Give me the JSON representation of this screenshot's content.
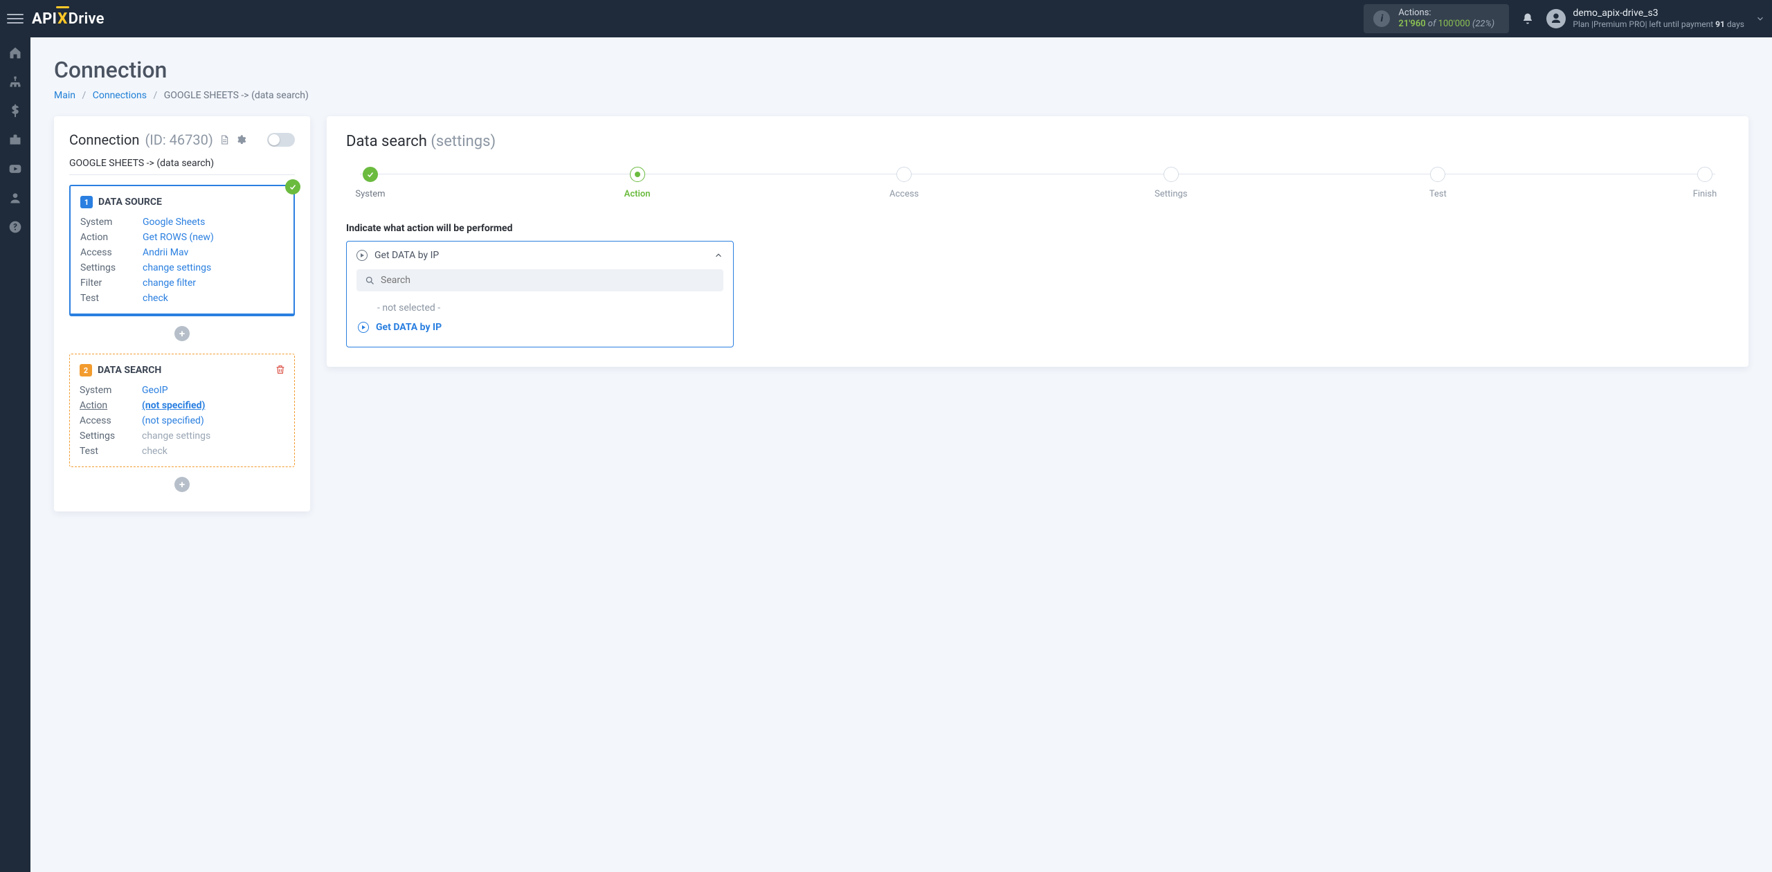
{
  "header": {
    "logo_parts": {
      "a": "API",
      "x": "X",
      "d": "Drive"
    },
    "actions_label": "Actions:",
    "actions_current": "21'960",
    "actions_of": " of ",
    "actions_total": "100'000",
    "actions_pct": "(22%)",
    "user_name": "demo_apix-drive_s3",
    "plan_prefix": "Plan ",
    "plan_name": "|Premium PRO|",
    "plan_suffix": " left until payment ",
    "plan_days": "91",
    "plan_days_unit": " days"
  },
  "page": {
    "title": "Connection",
    "crumb_main": "Main",
    "crumb_connections": "Connections",
    "crumb_current": "GOOGLE SHEETS -> (data search)"
  },
  "left_card": {
    "head_label": "Connection ",
    "head_id": "(ID: 46730)",
    "subtitle": "GOOGLE SHEETS -> (data search)",
    "block1": {
      "num": "1",
      "title": "DATA SOURCE",
      "rows": {
        "system_k": "System",
        "system_v": "Google Sheets",
        "action_k": "Action",
        "action_v": "Get ROWS (new)",
        "access_k": "Access",
        "access_v": "Andrii Mav",
        "settings_k": "Settings",
        "settings_v": "change settings",
        "filter_k": "Filter",
        "filter_v": "change filter",
        "test_k": "Test",
        "test_v": "check"
      }
    },
    "block2": {
      "num": "2",
      "title": "DATA SEARCH",
      "rows": {
        "system_k": "System",
        "system_v": "GeoIP",
        "action_k": "Action",
        "action_v": "(not specified)",
        "access_k": "Access",
        "access_v": "(not specified)",
        "settings_k": "Settings",
        "settings_v": "change settings",
        "test_k": "Test",
        "test_v": "check"
      }
    }
  },
  "right_card": {
    "title_main": "Data search ",
    "title_sub": "(settings)",
    "steps": [
      "System",
      "Action",
      "Access",
      "Settings",
      "Test",
      "Finish"
    ],
    "field_label": "Indicate what action will be performed",
    "dropdown": {
      "selected": "Get DATA by IP",
      "search_placeholder": "Search",
      "opt_not_selected": "- not selected -",
      "opt_get": "Get DATA by IP"
    }
  }
}
